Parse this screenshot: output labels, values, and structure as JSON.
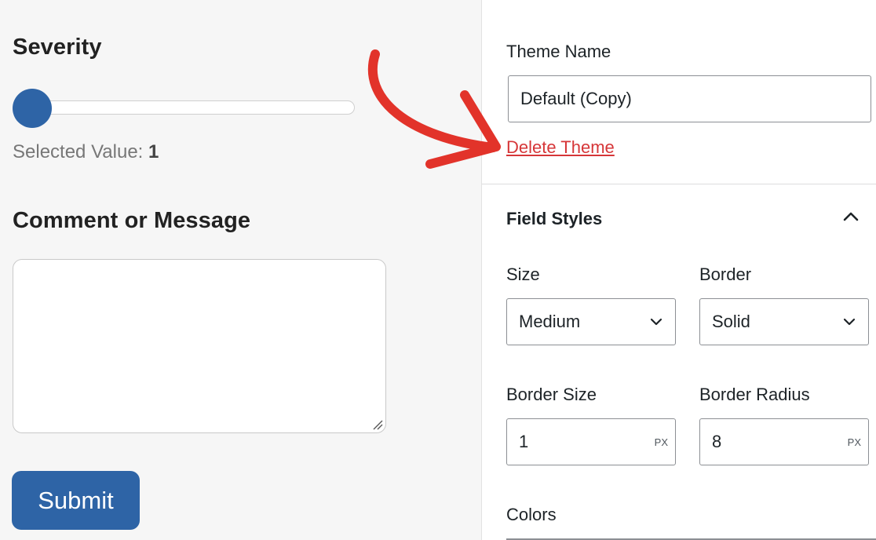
{
  "preview_form": {
    "severity": {
      "heading": "Severity",
      "slider_value": 1,
      "slider_min": 1,
      "selected_prefix": "Selected Value: ",
      "selected_value": "1"
    },
    "comment": {
      "heading": "Comment or Message",
      "value": ""
    },
    "submit_label": "Submit",
    "accent_color": "#2e64a6"
  },
  "theme_panel": {
    "theme_name_label": "Theme Name",
    "theme_name_value": "Default (Copy)",
    "delete_label": "Delete Theme",
    "delete_color": "#d63638",
    "field_styles": {
      "title": "Field Styles",
      "toggle_icon": "chevron-up-icon",
      "size": {
        "label": "Size",
        "value": "Medium",
        "icon": "chevron-down-icon"
      },
      "border": {
        "label": "Border",
        "value": "Solid",
        "icon": "chevron-down-icon"
      },
      "border_size": {
        "label": "Border Size",
        "value": "1",
        "unit": "PX"
      },
      "border_radius": {
        "label": "Border Radius",
        "value": "8",
        "unit": "PX"
      },
      "colors_label": "Colors"
    }
  },
  "annotation": {
    "arrow_icon": "curved-arrow-icon",
    "arrow_color": "#e2332a"
  }
}
